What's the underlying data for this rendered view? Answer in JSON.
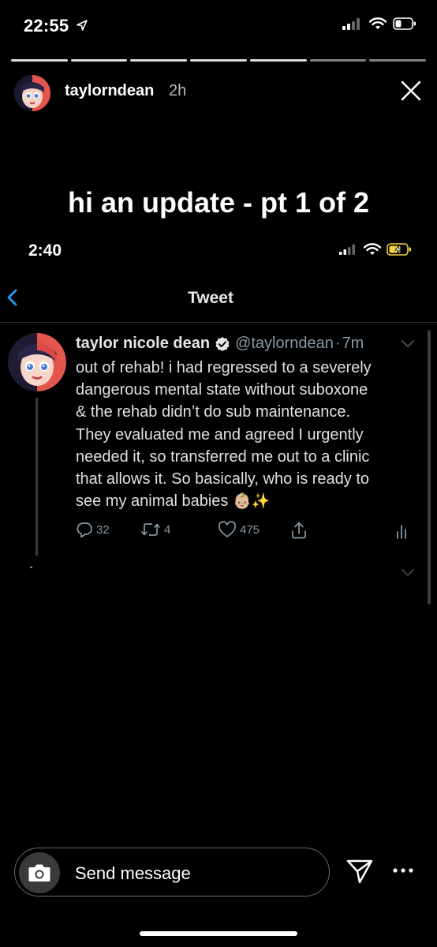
{
  "status_bar": {
    "time": "22:55"
  },
  "story": {
    "username": "taylorndean",
    "time_ago": "2h",
    "title": "hi an update - pt 1 of 2",
    "progress_segments": [
      {
        "state": "done"
      },
      {
        "state": "done"
      },
      {
        "state": "done"
      },
      {
        "state": "done"
      },
      {
        "state": "done"
      },
      {
        "state": "current"
      },
      {
        "state": "pending"
      }
    ]
  },
  "embedded_screenshot": {
    "status_time": "2:40",
    "header_title": "Tweet",
    "tweet": {
      "name": "taylor nicole dean",
      "handle": "@taylorndean",
      "separator": "·",
      "time": "7m",
      "text": "out of rehab! i had regressed to a severely\ndangerous mental state without suboxone\n& the rehab didn’t do sub maintenance.\nThey evaluated me and agreed I urgently\nneeded it, so transferred me out to a clinic\nthat allows it. So basically, who is ready to\nsee my animal babies ",
      "emoji": "👶🏼✨",
      "reply_count": "32",
      "retweet_count": "4",
      "like_count": "475"
    }
  },
  "message_bar": {
    "placeholder": "Send message"
  },
  "colors": {
    "background": "#000000",
    "handle": "#8899a6",
    "twitter_blue": "#1da1f2",
    "battery_charging": "#f5d33b"
  },
  "icons": [
    "location-arrow-icon",
    "signal-icon",
    "wifi-icon",
    "battery-icon",
    "close-icon",
    "back-chevron-icon",
    "verified-icon",
    "chevron-down-icon",
    "reply-icon",
    "retweet-icon",
    "heart-icon",
    "share-icon",
    "analytics-icon",
    "camera-icon",
    "send-icon",
    "more-icon"
  ]
}
